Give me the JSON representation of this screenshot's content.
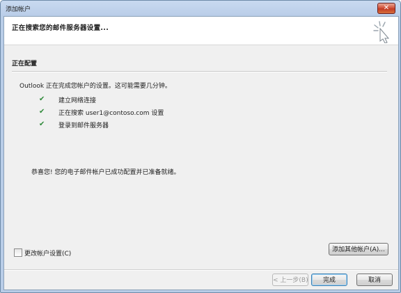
{
  "window": {
    "title": "添加帐户",
    "close_glyph": "✕"
  },
  "header": {
    "title": "正在搜索您的邮件服务器设置..."
  },
  "section": {
    "title": "正在配置"
  },
  "intro_text": "Outlook 正在完成您帐户的设置。这可能需要几分钟。",
  "steps": [
    {
      "label": "建立网络连接",
      "status": "done"
    },
    {
      "label": "正在搜索 user1@contoso.com 设置",
      "status": "done"
    },
    {
      "label": "登录到邮件服务器",
      "status": "done"
    }
  ],
  "check_glyph": "✔",
  "congrats_text": "恭喜您! 您的电子邮件帐户已成功配置并已准备就绪。",
  "change_settings": {
    "label": "更改帐户设置(C)",
    "checked": false
  },
  "buttons": {
    "add_other": "添加其他帐户(A)...",
    "back": "< 上一步(B)",
    "finish": "完成",
    "cancel": "取消"
  },
  "colors": {
    "check": "#2f8a3a",
    "titlebar": "#c9daf0",
    "close": "#c23a24"
  }
}
